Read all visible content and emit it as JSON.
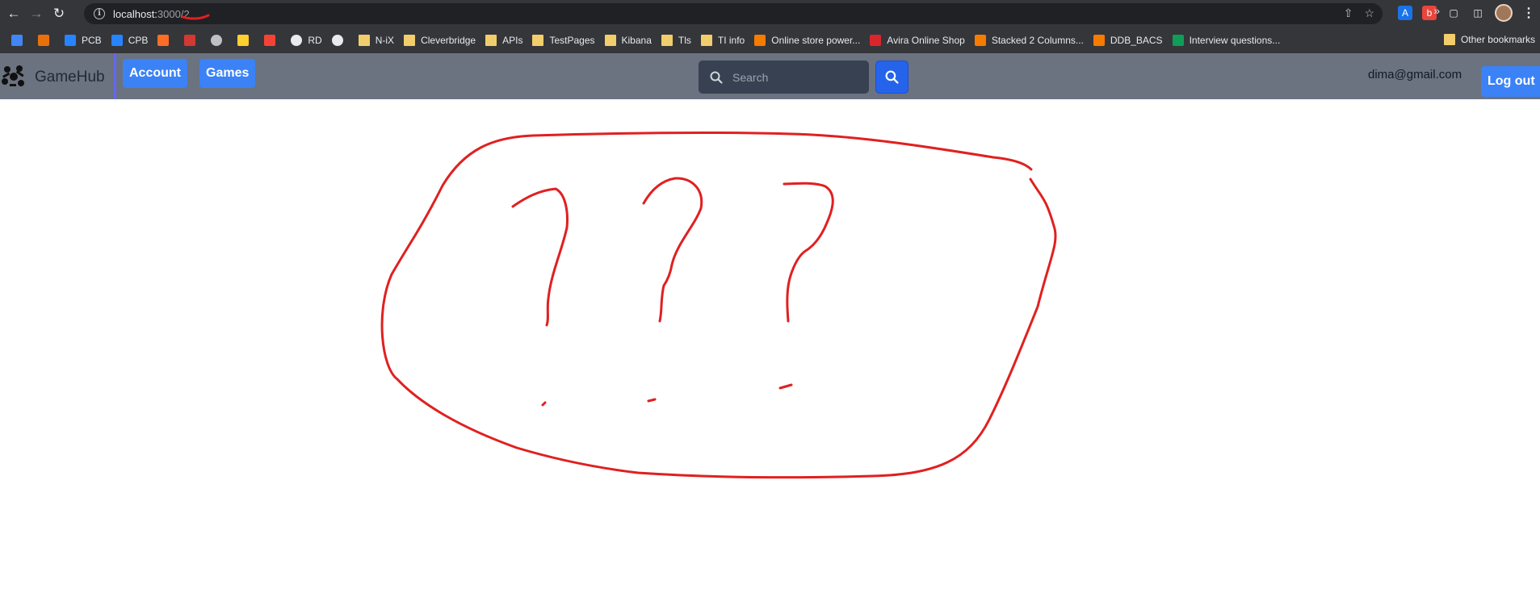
{
  "browser": {
    "url_host": "localhost:",
    "url_path": "3000/2"
  },
  "bookmarks": [
    {
      "label": "",
      "icon": "google-calendar-icon",
      "color": "#4285f4"
    },
    {
      "label": "",
      "icon": "orange-cube-icon",
      "color": "#e8710a"
    },
    {
      "label": "PCB",
      "icon": "jira-icon",
      "color": "#2684ff"
    },
    {
      "label": "CPB",
      "icon": "jira-icon",
      "color": "#2684ff"
    },
    {
      "label": "",
      "icon": "gitlab-icon",
      "color": "#fc6d26"
    },
    {
      "label": "",
      "icon": "jenkins-icon",
      "color": "#d33833"
    },
    {
      "label": "",
      "icon": "soccer-icon",
      "color": "#bdc1c6"
    },
    {
      "label": "",
      "icon": "miro-icon",
      "color": "#ffd02f"
    },
    {
      "label": "",
      "icon": "dots-icon",
      "color": "#f44336"
    },
    {
      "label": "RD",
      "icon": "globe-icon",
      "color": "#e8eaed"
    },
    {
      "label": "",
      "icon": "gear-icon",
      "color": "#e8eaed"
    },
    {
      "label": "N-iX",
      "icon": "folder-icon",
      "color": "#f2cd6b"
    },
    {
      "label": "Cleverbridge",
      "icon": "folder-icon",
      "color": "#f2cd6b"
    },
    {
      "label": "APIs",
      "icon": "folder-icon",
      "color": "#f2cd6b"
    },
    {
      "label": "TestPages",
      "icon": "folder-icon",
      "color": "#f2cd6b"
    },
    {
      "label": "Kibana",
      "icon": "folder-icon",
      "color": "#f2cd6b"
    },
    {
      "label": "Tls",
      "icon": "folder-icon",
      "color": "#f2cd6b"
    },
    {
      "label": "TI info",
      "icon": "folder-icon",
      "color": "#f2cd6b"
    },
    {
      "label": "Online store power...",
      "icon": "store-icon",
      "color": "#f57c00"
    },
    {
      "label": "Avira Online Shop",
      "icon": "avira-icon",
      "color": "#d9262d"
    },
    {
      "label": "Stacked 2 Columns...",
      "icon": "store-icon",
      "color": "#f57c00"
    },
    {
      "label": "DDB_BACS",
      "icon": "store-icon",
      "color": "#f57c00"
    },
    {
      "label": "Interview questions...",
      "icon": "sheets-icon",
      "color": "#0f9d58"
    }
  ],
  "bookmarks_more": "»",
  "other_bookmarks": "Other bookmarks",
  "app": {
    "brand": "GameHub",
    "nav": {
      "account": "Account",
      "games": "Games"
    },
    "search_placeholder": "Search",
    "user_email": "dima@gmail.com",
    "logout_label": "Log out"
  },
  "colors": {
    "accent": "#3b82f6",
    "header_bg": "#6b7280",
    "annotation": "#e02020"
  }
}
